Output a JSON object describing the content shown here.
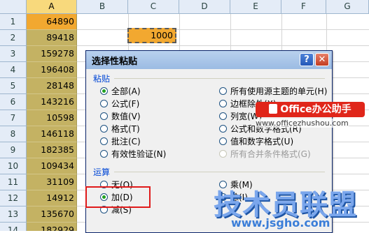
{
  "spreadsheet": {
    "columns": [
      "A",
      "B",
      "C",
      "D",
      "E",
      "F",
      "G"
    ],
    "rows": [
      "1",
      "2",
      "3",
      "4",
      "5",
      "6",
      "7",
      "8",
      "9",
      "10",
      "11",
      "12",
      "13",
      "14"
    ],
    "column_a_values": [
      "64890",
      "89418",
      "159278",
      "196408",
      "28148",
      "143216",
      "10598",
      "146118",
      "182385",
      "109434",
      "31109",
      "14912",
      "135670",
      "182929"
    ],
    "copied_cell_value": "1000"
  },
  "dialog": {
    "title": "选择性粘贴",
    "help_label": "?",
    "close_label": "✕",
    "paste_group": "粘贴",
    "paste_left": [
      "全部(A)",
      "公式(F)",
      "数值(V)",
      "格式(T)",
      "批注(C)",
      "有效性验证(N)"
    ],
    "paste_right": [
      "所有使用源主题的单元(H)",
      "边框除外(X)",
      "列宽(W)",
      "公式和数字格式(R)",
      "值和数字格式(U)",
      "所有合并条件格式(G)"
    ],
    "operation_group": "运算",
    "operation_left": [
      "无(O)",
      "加(D)",
      "减(S)"
    ],
    "operation_right": [
      "乘(M)",
      "除(I)"
    ]
  },
  "watermarks": {
    "office_label": "Office办公助手",
    "office_url": "www.officezhushou.com",
    "site_label": "技术员联盟",
    "site_url": "www.jsgho.com"
  }
}
